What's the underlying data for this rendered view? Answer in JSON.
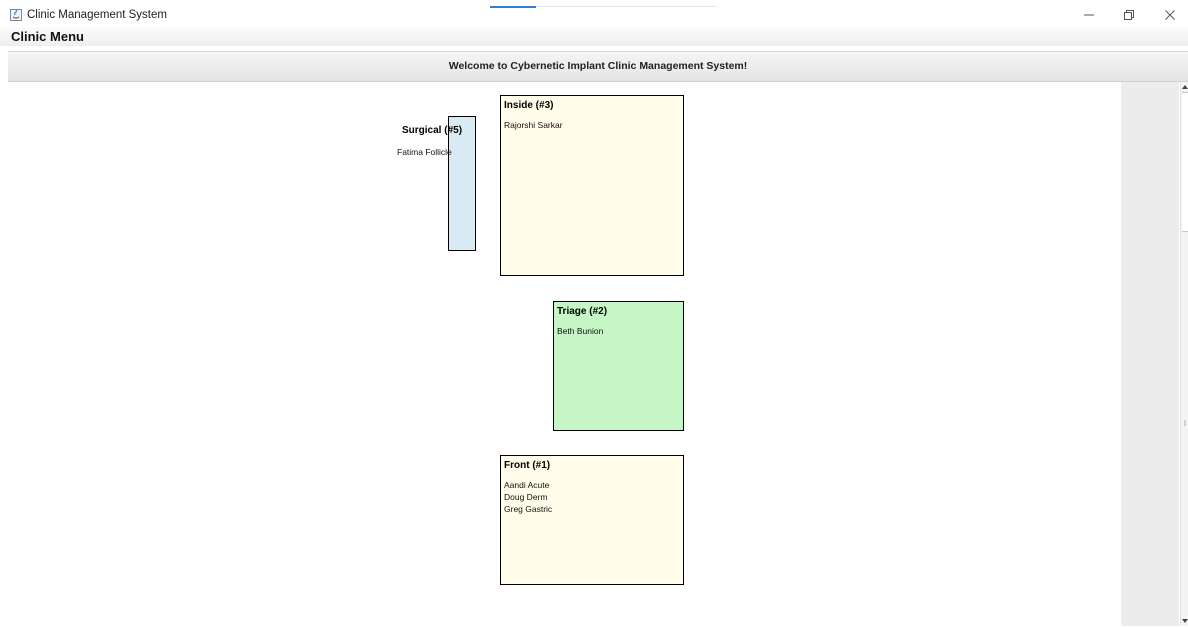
{
  "window": {
    "title": "Clinic Management System",
    "controls": {
      "minimize": "minimize-icon",
      "restore": "restore-icon",
      "close": "close-icon"
    }
  },
  "menu": {
    "items": [
      {
        "label": "Clinic Menu"
      }
    ]
  },
  "banner": {
    "text": "Welcome to Cybernetic Implant Clinic Management System!"
  },
  "rooms": [
    {
      "key": "inside",
      "title": "Inside (#3)",
      "color": "#fffde9",
      "patients": [
        "Rajorshi Sarkar"
      ]
    },
    {
      "key": "surgical",
      "title": "Surgical (#5)",
      "color": "#d9eaf4",
      "patients": [
        "Fatima Follicle"
      ]
    },
    {
      "key": "triage",
      "title": "Triage (#2)",
      "color": "#c6f5c6",
      "patients": [
        "Beth Bunion"
      ]
    },
    {
      "key": "front",
      "title": "Front (#1)",
      "color": "#fffde9",
      "patients": [
        "Aandi Acute",
        "Doug Derm",
        "Greg Gastric"
      ]
    }
  ],
  "colors": {
    "accent": "#2f7fd8",
    "border": "#000000"
  }
}
